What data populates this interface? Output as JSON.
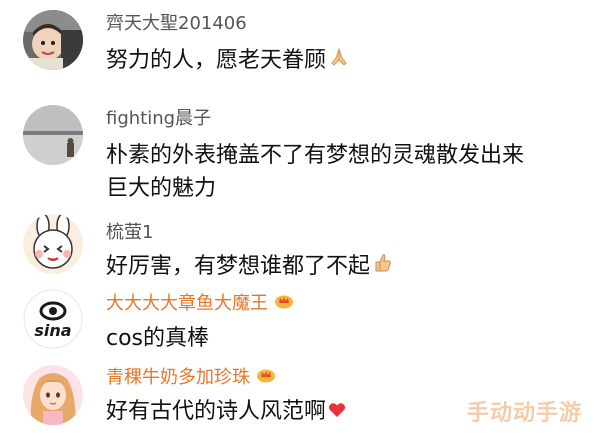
{
  "comments": [
    {
      "username": "齊天大聖201406",
      "lines": [
        "努力的人，愿老天眷顾"
      ],
      "avatar": "baby-photo-avatar",
      "trailing_icon": "praying-hands-icon"
    },
    {
      "username": "fighting晨子",
      "lines": [
        "朴素的外表掩盖不了有梦想的灵魂散发出来",
        "巨大的魅力"
      ],
      "avatar": "landscape-photo-avatar"
    },
    {
      "username": "梳萤1",
      "lines": [
        "好厉害，有梦想谁都了不起"
      ],
      "avatar": "cartoon-bunny-avatar",
      "trailing_icon": "thumbs-up-icon"
    },
    {
      "username": "大大大大章鱼大魔王",
      "lines": [
        "cos的真棒"
      ],
      "avatar": "sina-logo-avatar",
      "badge": "vip-crown-icon",
      "avatar_text": "sina"
    },
    {
      "username": "青稞牛奶多加珍珠",
      "lines": [
        "好有古代的诗人风范啊"
      ],
      "avatar": "anime-girl-avatar",
      "badge": "vip-crown-icon",
      "trailing_icon": "red-heart-icon"
    }
  ],
  "watermark": "手动动手游",
  "colors": {
    "username_gray": "#555555",
    "username_vip": "#e2782c",
    "text": "#111111",
    "heart": "#e8323c",
    "watermark": "#f2c59a"
  }
}
